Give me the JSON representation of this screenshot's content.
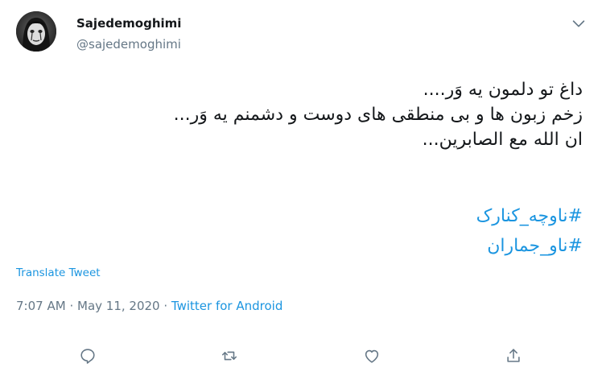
{
  "tweet": {
    "author": {
      "name": "Sajedemoghimi",
      "handle": "@sajedemoghimi",
      "avatar_icon": "avatar-photo"
    },
    "menu_icon": "chevron-down-icon",
    "text_lines": [
      "داغ تو دلمون یه وَر....",
      "زخم زبون ها و بی منطقی های دوست و دشمنم یه وَر...",
      "ان الله مع الصابرین..."
    ],
    "hashtags": [
      "#ناوچه_کنارک",
      "#ناو_جماران"
    ],
    "translate_label": "Translate Tweet",
    "time": "7:07 AM",
    "separator": "·",
    "date": "May 11, 2020",
    "source": "Twitter for Android",
    "actions": {
      "reply": "reply-icon",
      "retweet": "retweet-icon",
      "like": "heart-icon",
      "share": "share-icon"
    },
    "colors": {
      "link": "#1b95e0",
      "secondary": "#657786",
      "primary": "#14171a"
    }
  }
}
